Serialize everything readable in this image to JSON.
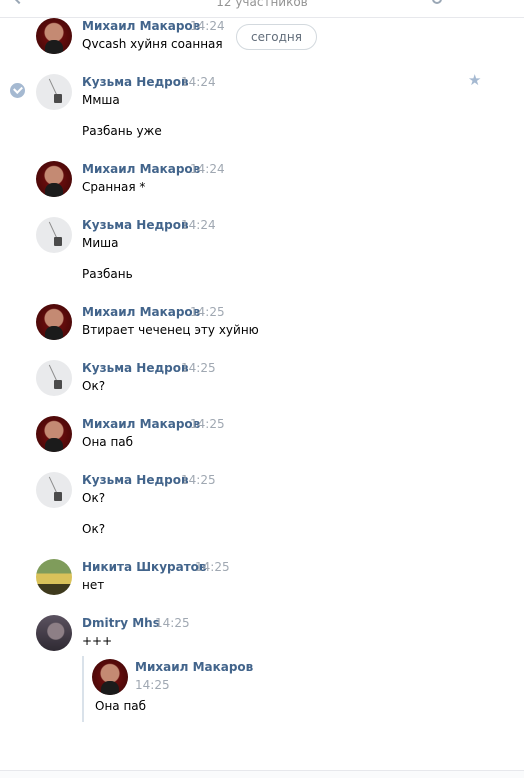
{
  "header": {
    "participants": "12 участников"
  },
  "date_divider": "сегодня",
  "messages": [
    {
      "author": "Михаил Макаров",
      "time": "14:24",
      "lines": [
        "Qvcash хуйня соанная"
      ]
    },
    {
      "author": "Кузьма Недров",
      "time": "14:24",
      "lines": [
        "Ммша",
        "Разбань уже"
      ]
    },
    {
      "author": "Михаил Макаров",
      "time": "14:24",
      "lines": [
        "Сранная *"
      ]
    },
    {
      "author": "Кузьма Недров",
      "time": "14:24",
      "lines": [
        "Миша",
        "Разбань"
      ]
    },
    {
      "author": "Михаил Макаров",
      "time": "14:25",
      "lines": [
        "Втирает чеченец эту хуйню"
      ]
    },
    {
      "author": "Кузьма Недров",
      "time": "14:25",
      "lines": [
        "Ок?"
      ]
    },
    {
      "author": "Михаил Макаров",
      "time": "14:25",
      "lines": [
        "Она паб"
      ]
    },
    {
      "author": "Кузьма Недров",
      "time": "14:25",
      "lines": [
        "Ок?",
        "Ок?"
      ]
    },
    {
      "author": "Никита Шкуратов",
      "time": "14:25",
      "lines": [
        "нет"
      ]
    },
    {
      "author": "Dmitry Mhs",
      "time": "14:25",
      "lines": [
        "+++"
      ]
    }
  ],
  "forwarded": {
    "author": "Михаил Макаров",
    "time": "14:25",
    "text": "Она паб"
  },
  "icons": {
    "back": "chevron-left-icon",
    "search": "search-icon",
    "selected": "check-icon",
    "favorite": "star-icon"
  },
  "colors": {
    "author_name": "#42648b",
    "timestamp": "#a0a8b2",
    "selection_check": "#a5b9d1"
  }
}
